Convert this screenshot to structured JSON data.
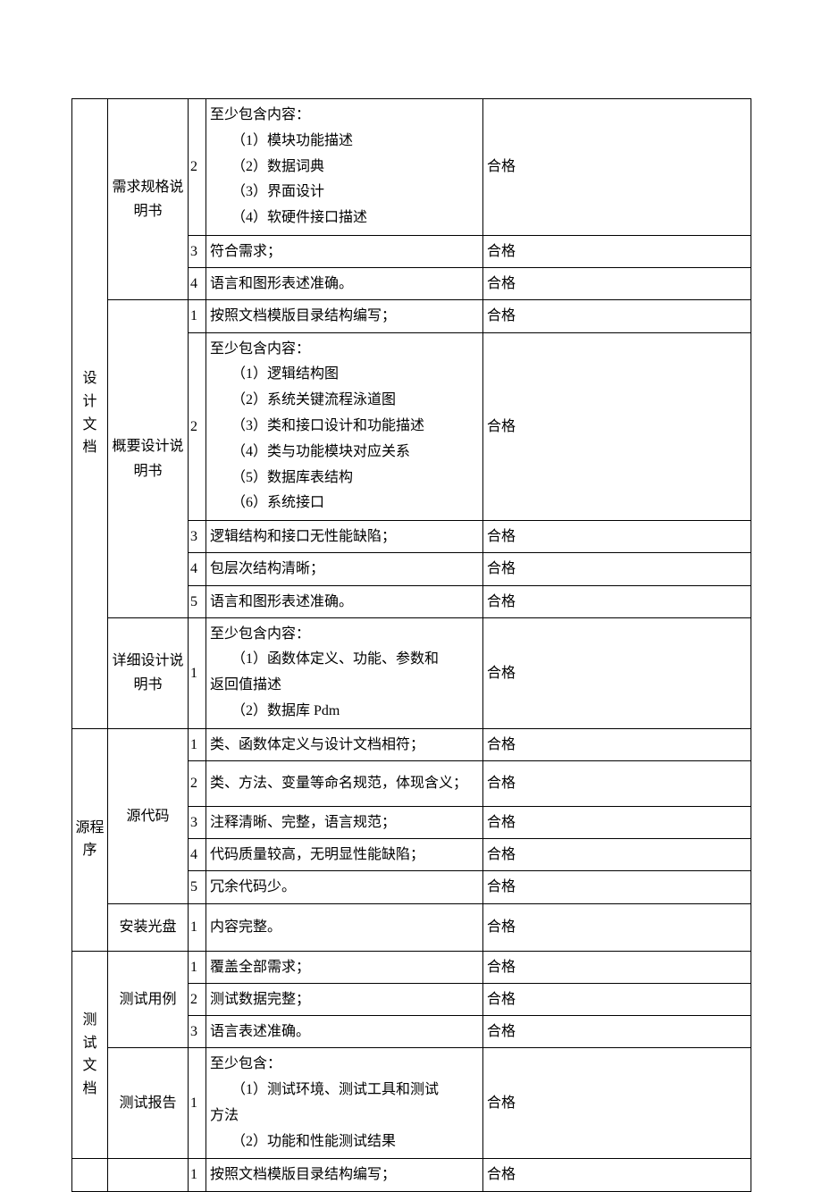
{
  "status_pass": "合格",
  "sections": {
    "design": {
      "label": "设计文档",
      "req_spec": {
        "label": "需求规格说明书",
        "r2": {
          "num": "2",
          "lead": "至少包含内容：",
          "i1": "（1）模块功能描述",
          "i2": "（2）数据词典",
          "i3": "（3）界面设计",
          "i4": "（4）软硬件接口描述"
        },
        "r3": {
          "num": "3",
          "desc": "符合需求；"
        },
        "r4": {
          "num": "4",
          "desc": "语言和图形表述准确。"
        }
      },
      "overview": {
        "label": "概要设计说明书",
        "r1": {
          "num": "1",
          "desc": "按照文档模版目录结构编写；"
        },
        "r2": {
          "num": "2",
          "lead": "至少包含内容：",
          "i1": "（1）逻辑结构图",
          "i2": "（2）系统关键流程泳道图",
          "i3": "（3）类和接口设计和功能描述",
          "i4": "（4）类与功能模块对应关系",
          "i5": "（5）数据库表结构",
          "i6": "（6）系统接口"
        },
        "r3": {
          "num": "3",
          "desc": "逻辑结构和接口无性能缺陷；"
        },
        "r4": {
          "num": "4",
          "desc": "包层次结构清晰；"
        },
        "r5": {
          "num": "5",
          "desc": "语言和图形表述准确。"
        }
      },
      "detail": {
        "label": "详细设计说明书",
        "r1": {
          "num": "1",
          "lead": "至少包含内容：",
          "i1": "（1）函数体定义、功能、参数和",
          "i1b": "返回值描述",
          "i2": "（2）数据库 Pdm"
        }
      }
    },
    "source": {
      "label": "源程序",
      "code": {
        "label": "源代码",
        "r1": {
          "num": "1",
          "desc": "类、函数体定义与设计文档相符；"
        },
        "r2": {
          "num": "2",
          "desc": "类、方法、变量等命名规范，体现含义；"
        },
        "r3": {
          "num": "3",
          "desc": "注释清晰、完整，语言规范；"
        },
        "r4": {
          "num": "4",
          "desc": "代码质量较高，无明显性能缺陷；"
        },
        "r5": {
          "num": "5",
          "desc": "冗余代码少。"
        }
      },
      "disc": {
        "label": "安装光盘",
        "r1": {
          "num": "1",
          "desc": "内容完整。"
        }
      }
    },
    "test": {
      "label": "测试文档",
      "cases": {
        "label": "测试用例",
        "r1": {
          "num": "1",
          "desc": "覆盖全部需求；"
        },
        "r2": {
          "num": "2",
          "desc": "测试数据完整；"
        },
        "r3": {
          "num": "3",
          "desc": "语言表述准确。"
        }
      },
      "report": {
        "label": "测试报告",
        "r1": {
          "num": "1",
          "lead": "至少包含：",
          "i1": "（1）测试环境、测试工具和测试",
          "i1b": "方法",
          "i2": "（2）功能和性能测试结果"
        }
      }
    },
    "extra": {
      "r1": {
        "num": "1",
        "desc": "按照文档模版目录结构编写；"
      }
    }
  }
}
